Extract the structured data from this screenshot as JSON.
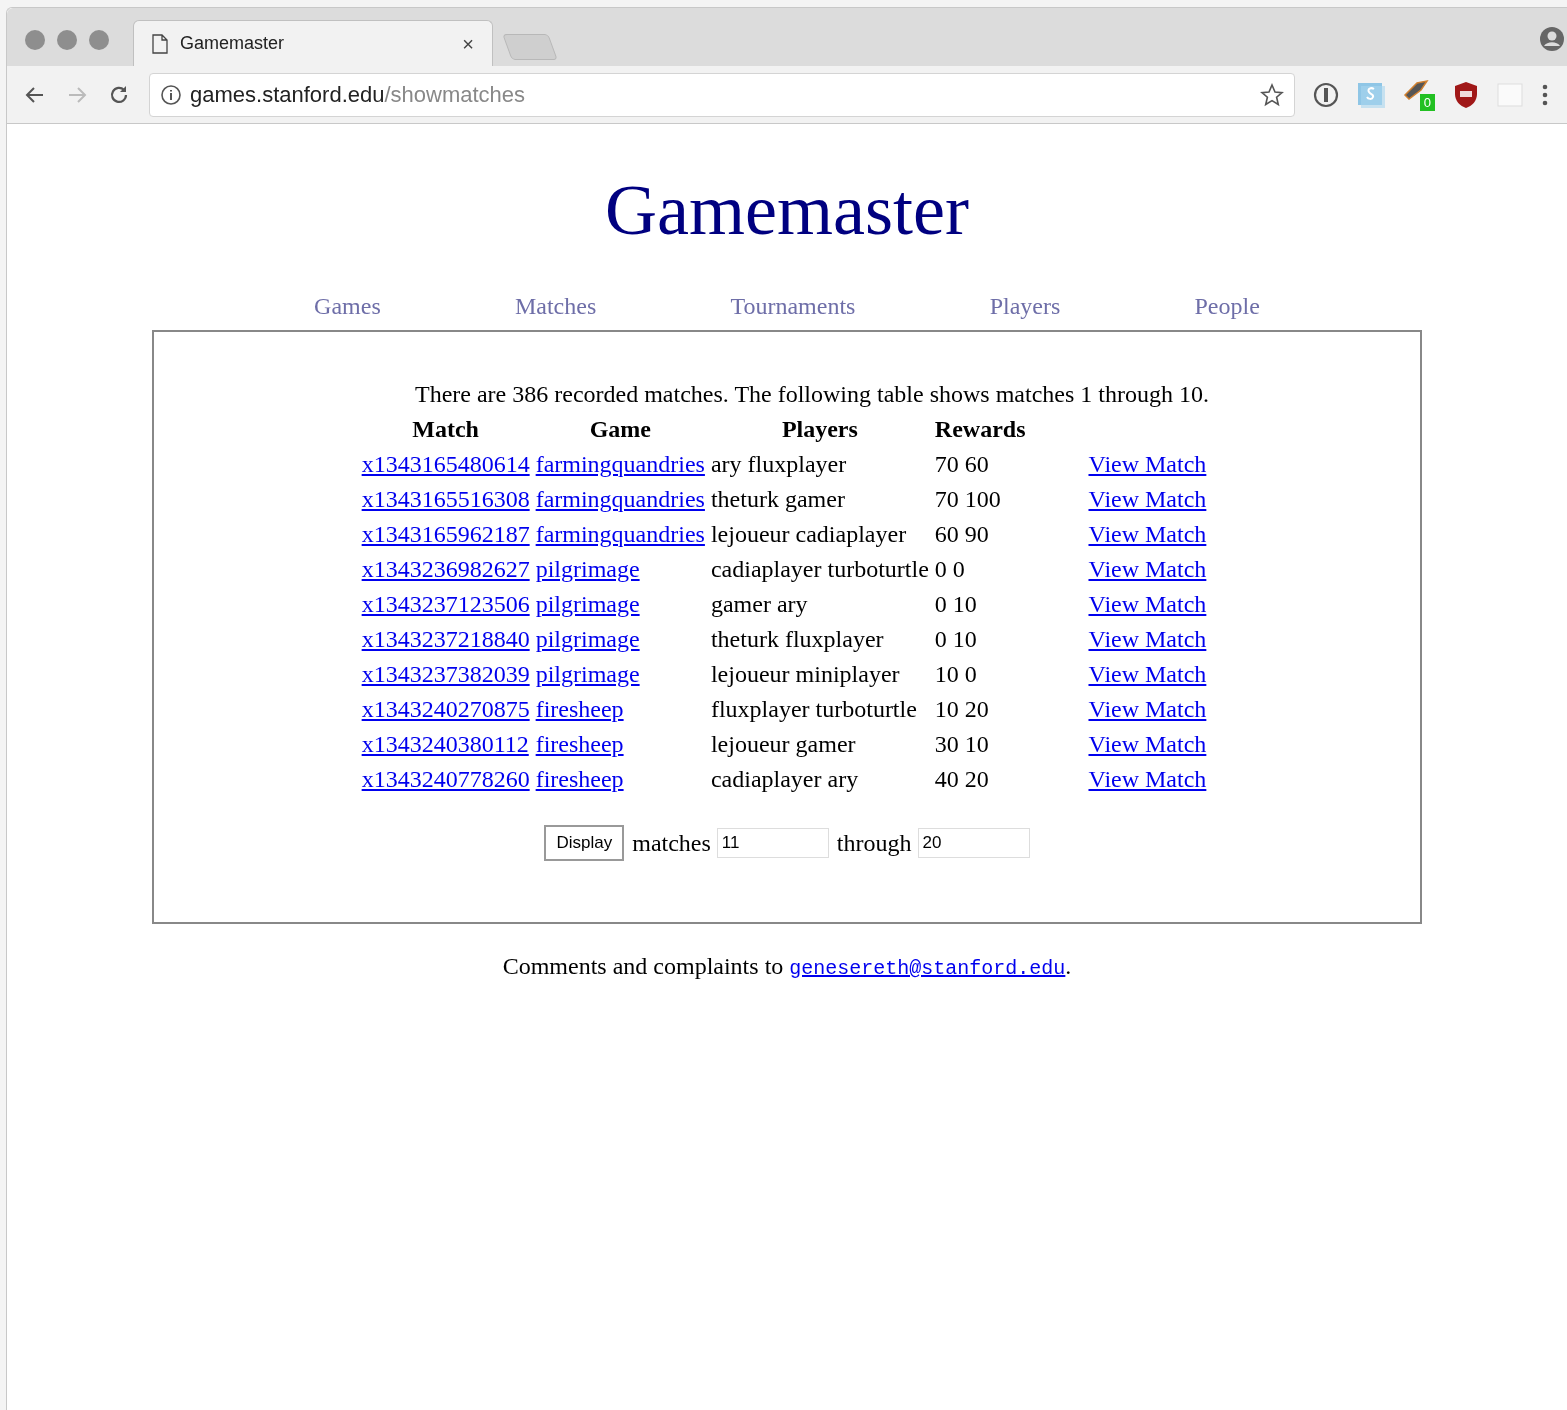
{
  "tab": {
    "title": "Gamemaster",
    "close": "×"
  },
  "address_bar": {
    "host": "games.stanford.edu",
    "path": "/showmatches"
  },
  "extension_badge": "0",
  "page": {
    "title": "Gamemaster",
    "nav": [
      "Games",
      "Matches",
      "Tournaments",
      "Players",
      "People"
    ],
    "summary": "There are 386 recorded matches. The following table shows matches 1 through 10.",
    "table": {
      "columns": [
        "Match",
        "Game",
        "Players",
        "Rewards"
      ],
      "rows": [
        {
          "match": "x1343165480614",
          "game": "farmingquandries",
          "players": "ary fluxplayer",
          "rewards": "70 60",
          "link": "View Match"
        },
        {
          "match": "x1343165516308",
          "game": "farmingquandries",
          "players": "theturk gamer",
          "rewards": "70 100",
          "link": "View Match"
        },
        {
          "match": "x1343165962187",
          "game": "farmingquandries",
          "players": "lejoueur cadiaplayer",
          "rewards": "60 90",
          "link": "View Match"
        },
        {
          "match": "x1343236982627",
          "game": "pilgrimage",
          "players": "cadiaplayer turboturtle",
          "rewards": "0 0",
          "link": "View Match"
        },
        {
          "match": "x1343237123506",
          "game": "pilgrimage",
          "players": "gamer ary",
          "rewards": "0 10",
          "link": "View Match"
        },
        {
          "match": "x1343237218840",
          "game": "pilgrimage",
          "players": "theturk fluxplayer",
          "rewards": "0 10",
          "link": "View Match"
        },
        {
          "match": "x1343237382039",
          "game": "pilgrimage",
          "players": "lejoueur miniplayer",
          "rewards": "10 0",
          "link": "View Match"
        },
        {
          "match": "x1343240270875",
          "game": "firesheep",
          "players": "fluxplayer turboturtle",
          "rewards": "10 20",
          "link": "View Match"
        },
        {
          "match": "x1343240380112",
          "game": "firesheep",
          "players": "lejoueur gamer",
          "rewards": "30 10",
          "link": "View Match"
        },
        {
          "match": "x1343240778260",
          "game": "firesheep",
          "players": "cadiaplayer ary",
          "rewards": "40 20",
          "link": "View Match"
        }
      ]
    },
    "form": {
      "button": "Display",
      "label_from": "matches",
      "from_value": "11",
      "label_to": "through",
      "to_value": "20"
    },
    "footer": {
      "text": "Comments and complaints to ",
      "email": "genesereth@stanford.edu",
      "end": "."
    }
  }
}
